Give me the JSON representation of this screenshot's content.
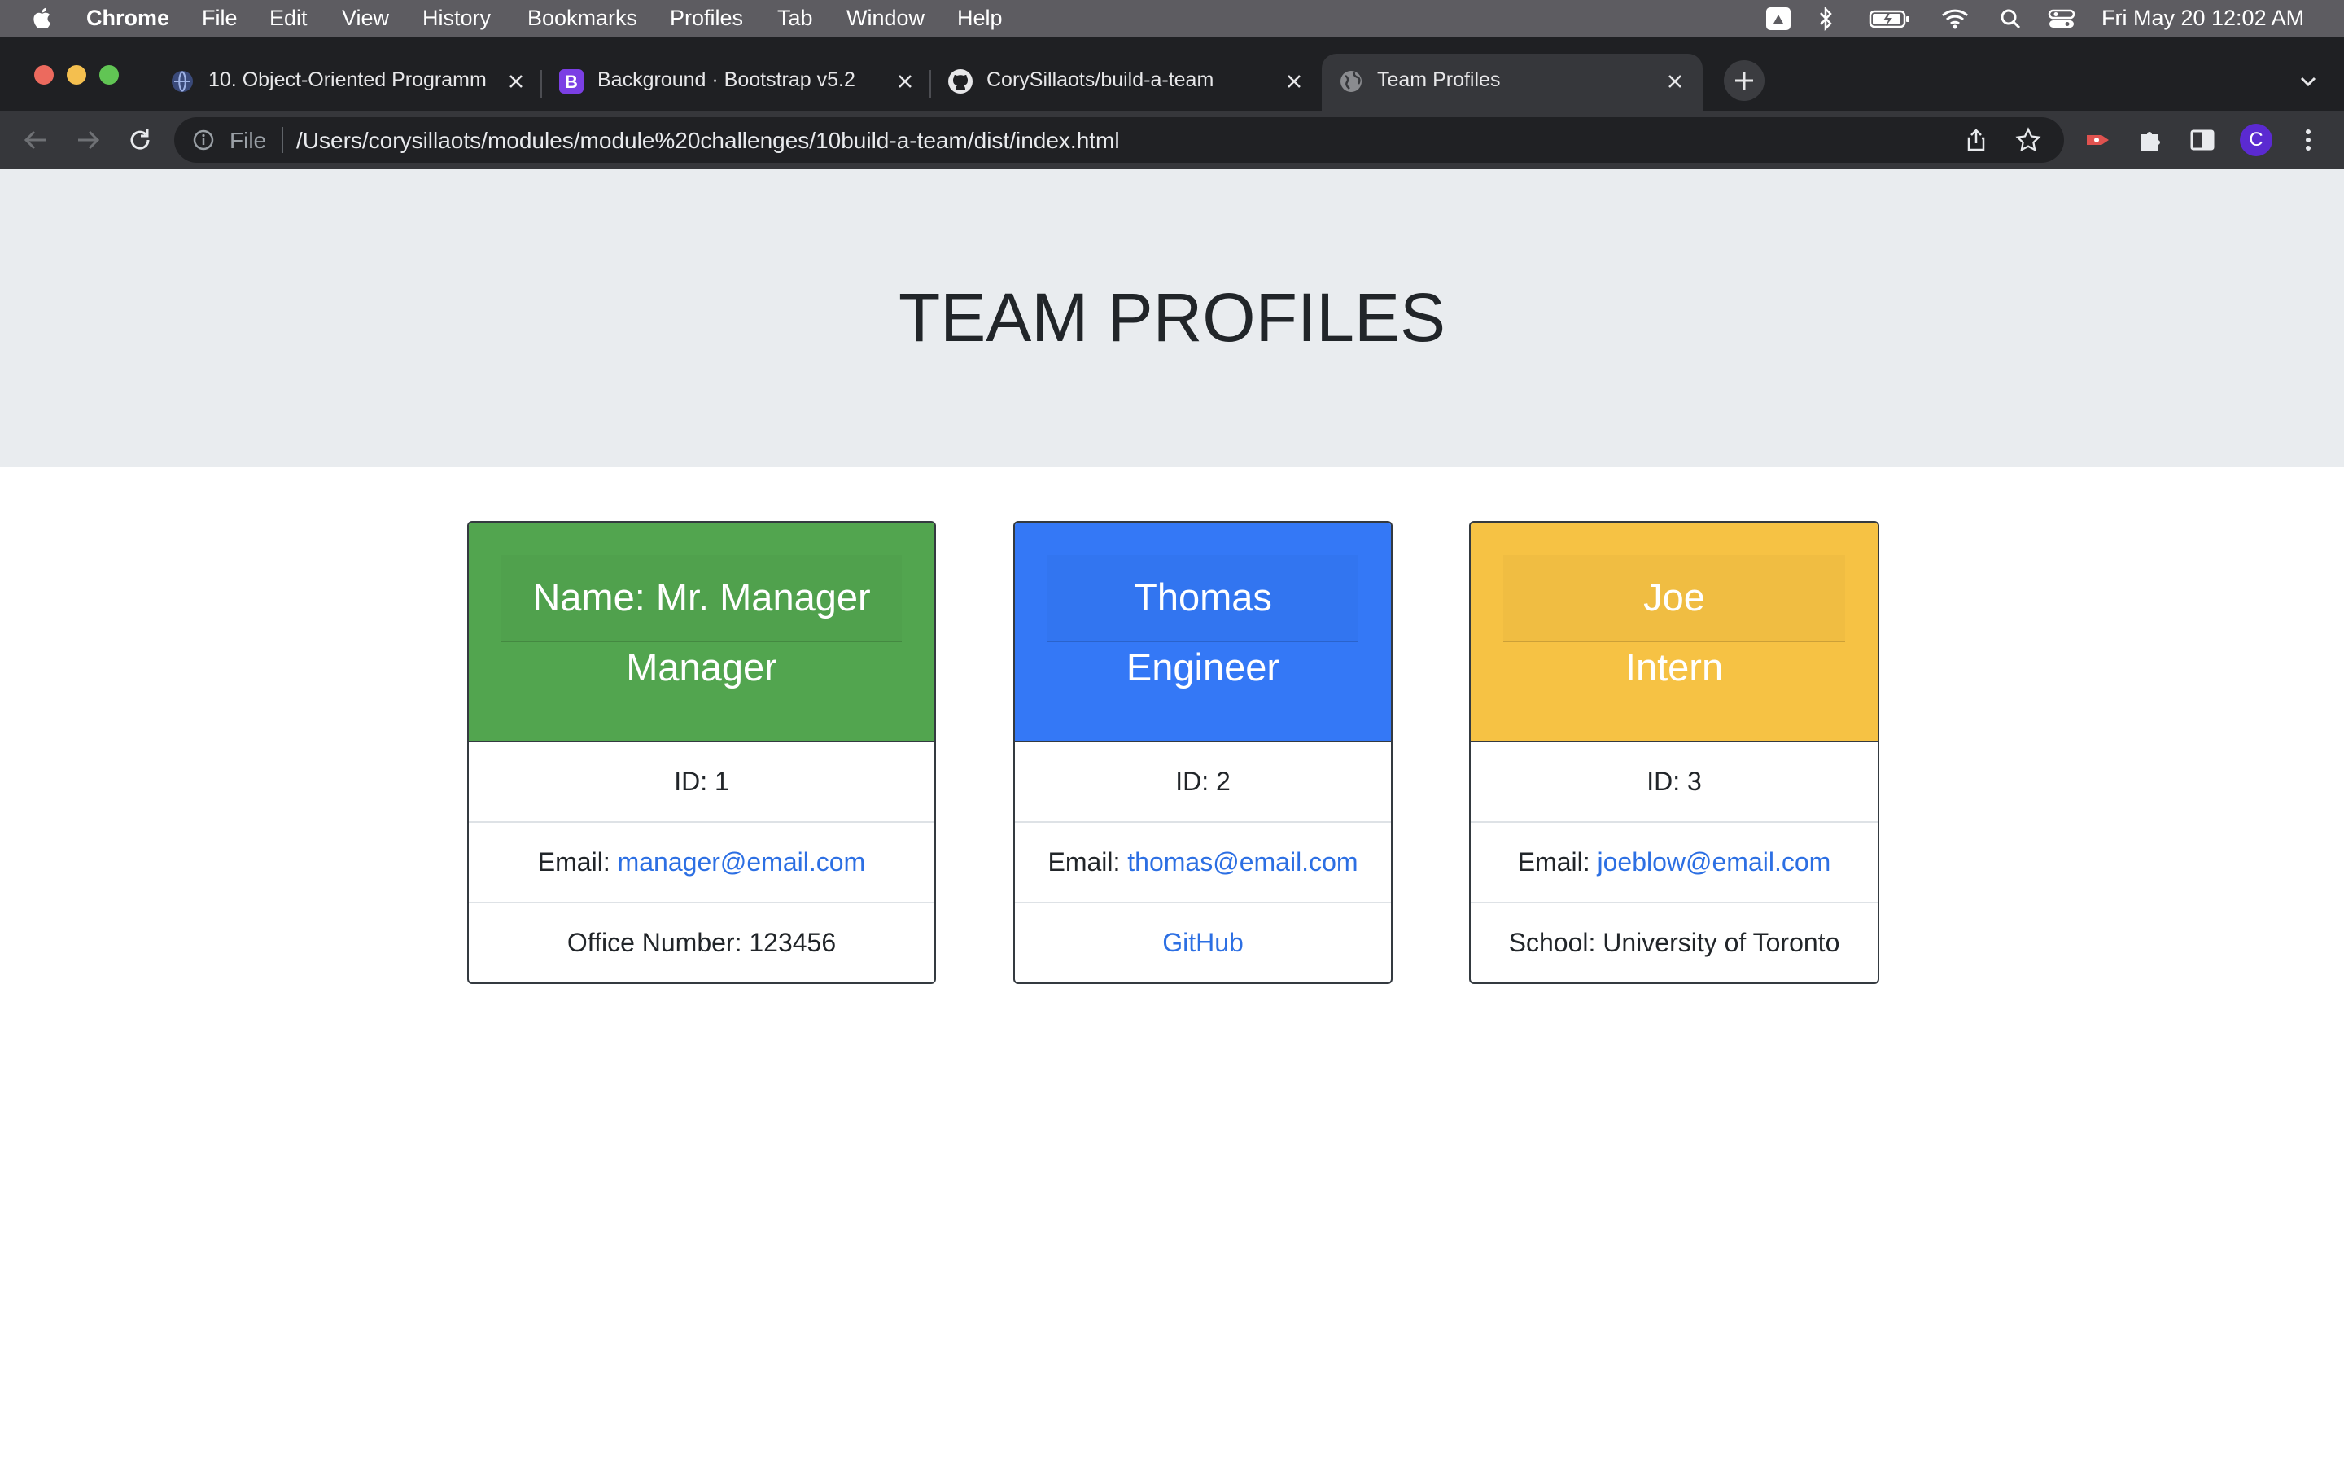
{
  "menubar": {
    "app_name": "Chrome",
    "items": [
      "File",
      "Edit",
      "View",
      "History",
      "Bookmarks",
      "Profiles",
      "Tab",
      "Window",
      "Help"
    ],
    "clock": "Fri May 20  12:02 AM"
  },
  "tabs": [
    {
      "title": "10. Object-Oriented Programm",
      "favicon": "course-icon",
      "active": false
    },
    {
      "title": "Background · Bootstrap v5.2",
      "favicon": "bootstrap-icon",
      "active": false
    },
    {
      "title": "CorySillaots/build-a-team",
      "favicon": "github-icon",
      "active": false
    },
    {
      "title": "Team Profiles",
      "favicon": "globe-icon",
      "active": true
    }
  ],
  "toolbar": {
    "scheme": "File",
    "url": "/Users/corysillaots/modules/module%20challenges/10build-a-team/dist/index.html",
    "avatar_letter": "C"
  },
  "page": {
    "heading": "TEAM PROFILES",
    "cards": [
      {
        "name": "Name: Mr. Manager",
        "role": "Manager",
        "id": "ID: 1",
        "email_label": "Email: ",
        "email": "manager@email.com",
        "extra": "Office Number: 123456",
        "header_color": "#52a54f"
      },
      {
        "name": "Thomas",
        "role": "Engineer",
        "id": "ID: 2",
        "email_label": "Email: ",
        "email": "thomas@email.com",
        "extra_link": "GitHub",
        "header_color": "#3478f6"
      },
      {
        "name": "Joe",
        "role": "Intern",
        "id": "ID: 3",
        "email_label": "Email: ",
        "email": "joeblow@email.com",
        "extra": "School: University of Toronto",
        "header_color": "#f6c244"
      }
    ]
  },
  "colors": {
    "link": "#2c6fe3",
    "jumbotron_bg": "#e9ecef"
  }
}
